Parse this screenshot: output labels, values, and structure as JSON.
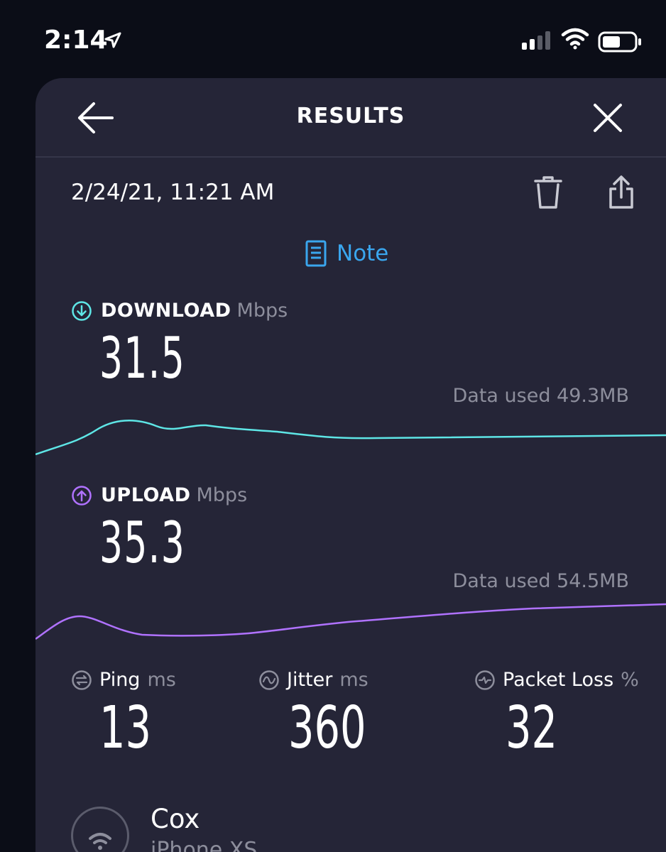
{
  "status_bar": {
    "time": "2:14",
    "icons": [
      "location-arrow-icon",
      "cellular-signal-icon",
      "wifi-icon",
      "battery-icon"
    ]
  },
  "header": {
    "title": "RESULTS",
    "back_icon": "arrow-left-icon",
    "close_icon": "close-icon"
  },
  "result": {
    "timestamp": "2/24/21, 11:21 AM",
    "note_label": "Note"
  },
  "download": {
    "label": "DOWNLOAD",
    "unit": "Mbps",
    "value": "31.5",
    "data_used": "Data used 49.3MB",
    "color": "#5ee6e6"
  },
  "upload": {
    "label": "UPLOAD",
    "unit": "Mbps",
    "value": "35.3",
    "data_used": "Data used 54.5MB",
    "color": "#b072ff"
  },
  "ping": {
    "label": "Ping",
    "unit": "ms",
    "value": "13"
  },
  "jitter": {
    "label": "Jitter",
    "unit": "ms",
    "value": "360"
  },
  "packet_loss": {
    "label": "Packet Loss",
    "unit": "%",
    "value": "32"
  },
  "provider": {
    "name": "Cox",
    "device": "iPhone XS"
  },
  "colors": {
    "background": "#0b0d17",
    "card": "#252537",
    "accent_blue": "#3aa6ee",
    "muted_text": "#8d8e9c"
  }
}
